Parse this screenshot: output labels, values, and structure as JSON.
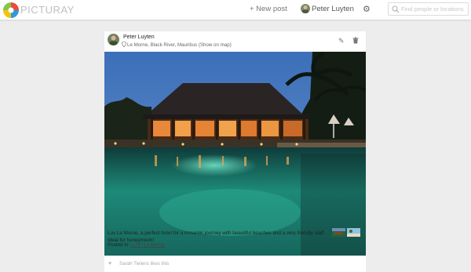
{
  "app": {
    "name": "PICTURAY"
  },
  "nav": {
    "new_post_label": "+ New post",
    "user_name": "Peter Luyten",
    "search_placeholder": "Find people or locations"
  },
  "post": {
    "author": "Peter Luyten",
    "location": "Le Morne, Black River, Mauritius",
    "show_on_map": "(Show on map)",
    "description": "Lux Le Morne, a perfect hotel for a romantic journey with beautiful beaches and a very friendly staff. Ideal for honeymoon!",
    "posted_in_label": "Posted in:",
    "posted_in_link": "LUX* Le Morne"
  },
  "likes": {
    "text": "Sarah Tielens likes this"
  },
  "colors": {
    "background": "#ededed",
    "card": "#ffffff",
    "logo_green": "#8bc34a",
    "logo_red": "#e74c3c",
    "logo_blue": "#3498db",
    "logo_yellow": "#f1c40f"
  },
  "icons": [
    "logo-icon",
    "gear-icon",
    "search-icon",
    "pin-icon",
    "edit-icon",
    "trash-icon",
    "heart-icon"
  ]
}
